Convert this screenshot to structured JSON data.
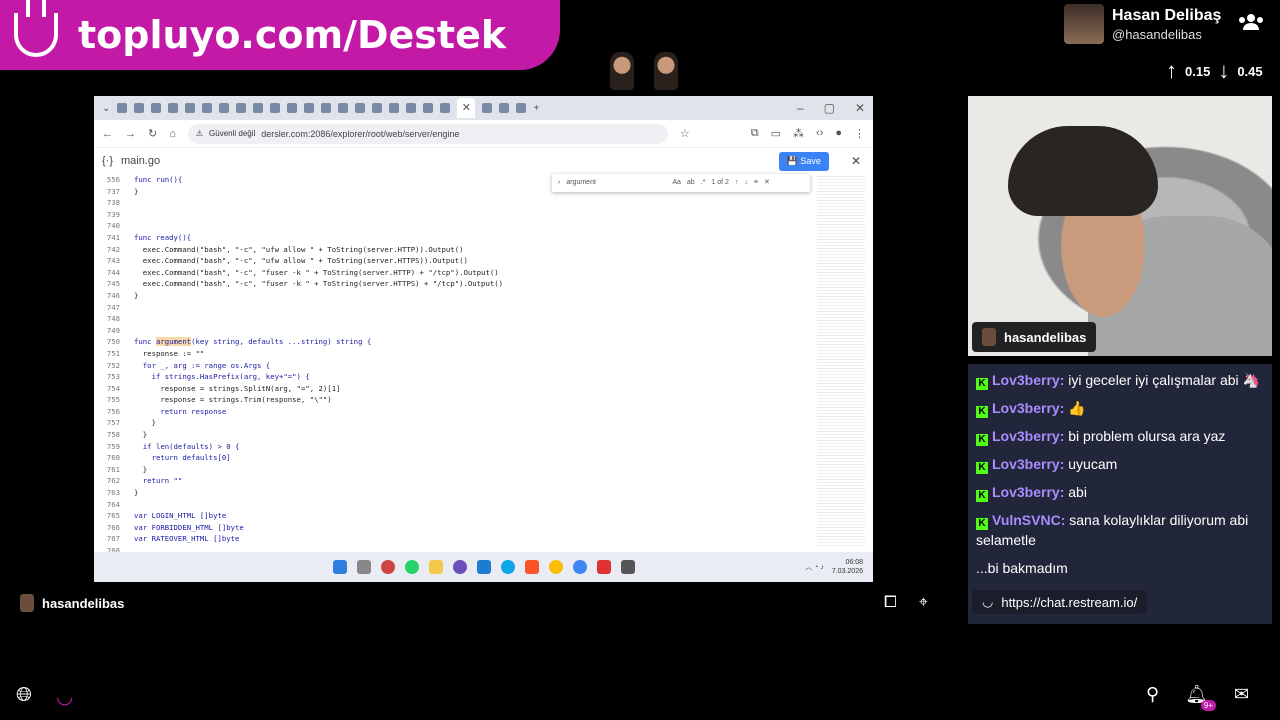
{
  "banner": {
    "text": "topluyo.com/Destek"
  },
  "profile": {
    "name": "Hasan Delibaş",
    "handle": "@hasandelibas"
  },
  "votes": {
    "up": "0.15",
    "down": "0.45"
  },
  "browser": {
    "url": "dersler.com:2086/explorer/root/web/server/engine",
    "insecure_label": "Güvenli değil",
    "file_name": "main.go",
    "save_label": "Save",
    "find": {
      "query": "argument",
      "count": "1 of 2"
    },
    "gutter": [
      "556",
      "737",
      "738",
      "739",
      "740",
      "741",
      "742",
      "743",
      "744",
      "745",
      "746",
      "747",
      "748",
      "749",
      "750",
      "751",
      "752",
      "753",
      "754",
      "755",
      "756",
      "757",
      "758",
      "759",
      "760",
      "761",
      "762",
      "763",
      "764",
      "765",
      "766",
      "767",
      "768"
    ],
    "code": [
      "func run(){",
      "}",
      "",
      "",
      "",
      "func ready(){",
      "  exec.Command(\"bash\", \"-c\", \"ufw allow \" + ToString(server.HTTP)).Output()",
      "  exec.Command(\"bash\", \"-c\", \"ufw allow \" + ToString(server.HTTPS)).Output()",
      "  exec.Command(\"bash\", \"-c\", \"fuser -k \" + ToString(server.HTTP) + \"/tcp\").Output()",
      "  exec.Command(\"bash\", \"-c\", \"fuser -k \" + ToString(server.HTTPS) + \"/tcp\").Output()",
      "}",
      "",
      "",
      "",
      "func argument(key string, defaults ...string) string {",
      "  response := \"\"",
      "  for _, arg := range os.Args {",
      "    if strings.HasPrefix(arg, key+\"=\") {",
      "      response = strings.SplitN(arg, \"=\", 2)[1]",
      "      response = strings.Trim(response, \"\\\"\")",
      "      return response",
      "    }",
      "  }",
      "  if len(defaults) > 0 {",
      "    return defaults[0]",
      "  }",
      "  return \"\"",
      "}",
      "",
      "var LOGIN_HTML []byte",
      "var FORBIDDEN_HTML []byte",
      "var RATEOVER_HTML []byte"
    ],
    "tray": {
      "time": "06:08",
      "date": "7.03.2026"
    }
  },
  "streamer": {
    "name": "hasandelibas"
  },
  "webcam": {
    "label": "hasandelibas"
  },
  "chat": [
    {
      "user": "Lov3berry",
      "text": "iyi geceler iyi çalışmalar abi 🦄"
    },
    {
      "user": "Lov3berry",
      "text": "👍"
    },
    {
      "user": "Lov3berry",
      "text": "bi problem olursa ara yaz"
    },
    {
      "user": "Lov3berry",
      "text": "uyucam"
    },
    {
      "user": "Lov3berry",
      "text": "abi"
    },
    {
      "user": "VulnSVNC",
      "text": "sana kolaylıklar diliyorum abi selametle"
    },
    {
      "user": "",
      "text": "...bi bakmadım"
    }
  ],
  "chat_url": "https://chat.restream.io/",
  "notifications_badge": "9+"
}
